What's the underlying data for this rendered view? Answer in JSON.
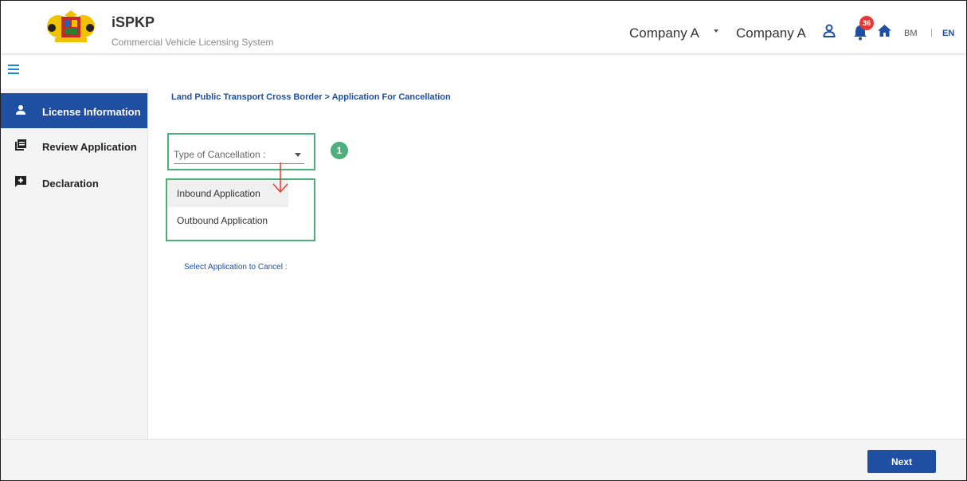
{
  "header": {
    "app_title": "iSPKP",
    "app_subtitle": "Commercial Vehicle Licensing System",
    "company_selector": "Company A",
    "company_name": "Company A",
    "notification_count": "36",
    "lang_bm": "BM",
    "lang_separator": "|",
    "lang_en": "EN"
  },
  "sidebar": {
    "items": [
      {
        "label": "License Information",
        "icon": "person-icon",
        "active": true
      },
      {
        "label": "Review Application",
        "icon": "document-list-icon",
        "active": false
      },
      {
        "label": "Declaration",
        "icon": "comment-plus-icon",
        "active": false
      }
    ]
  },
  "main": {
    "breadcrumb": "Land Public Transport Cross Border > Application For Cancellation",
    "cancellation_select": {
      "label": "Type of Cancellation :",
      "options": [
        "Inbound Application",
        "Outbound Application"
      ]
    },
    "step_number": "1",
    "select_app_label": "Select Application to Cancel :"
  },
  "footer": {
    "next_label": "Next"
  },
  "colors": {
    "primary": "#1f4fa3",
    "highlight": "#4caf7c",
    "badge": "#e53935",
    "arrow": "#e53935"
  }
}
